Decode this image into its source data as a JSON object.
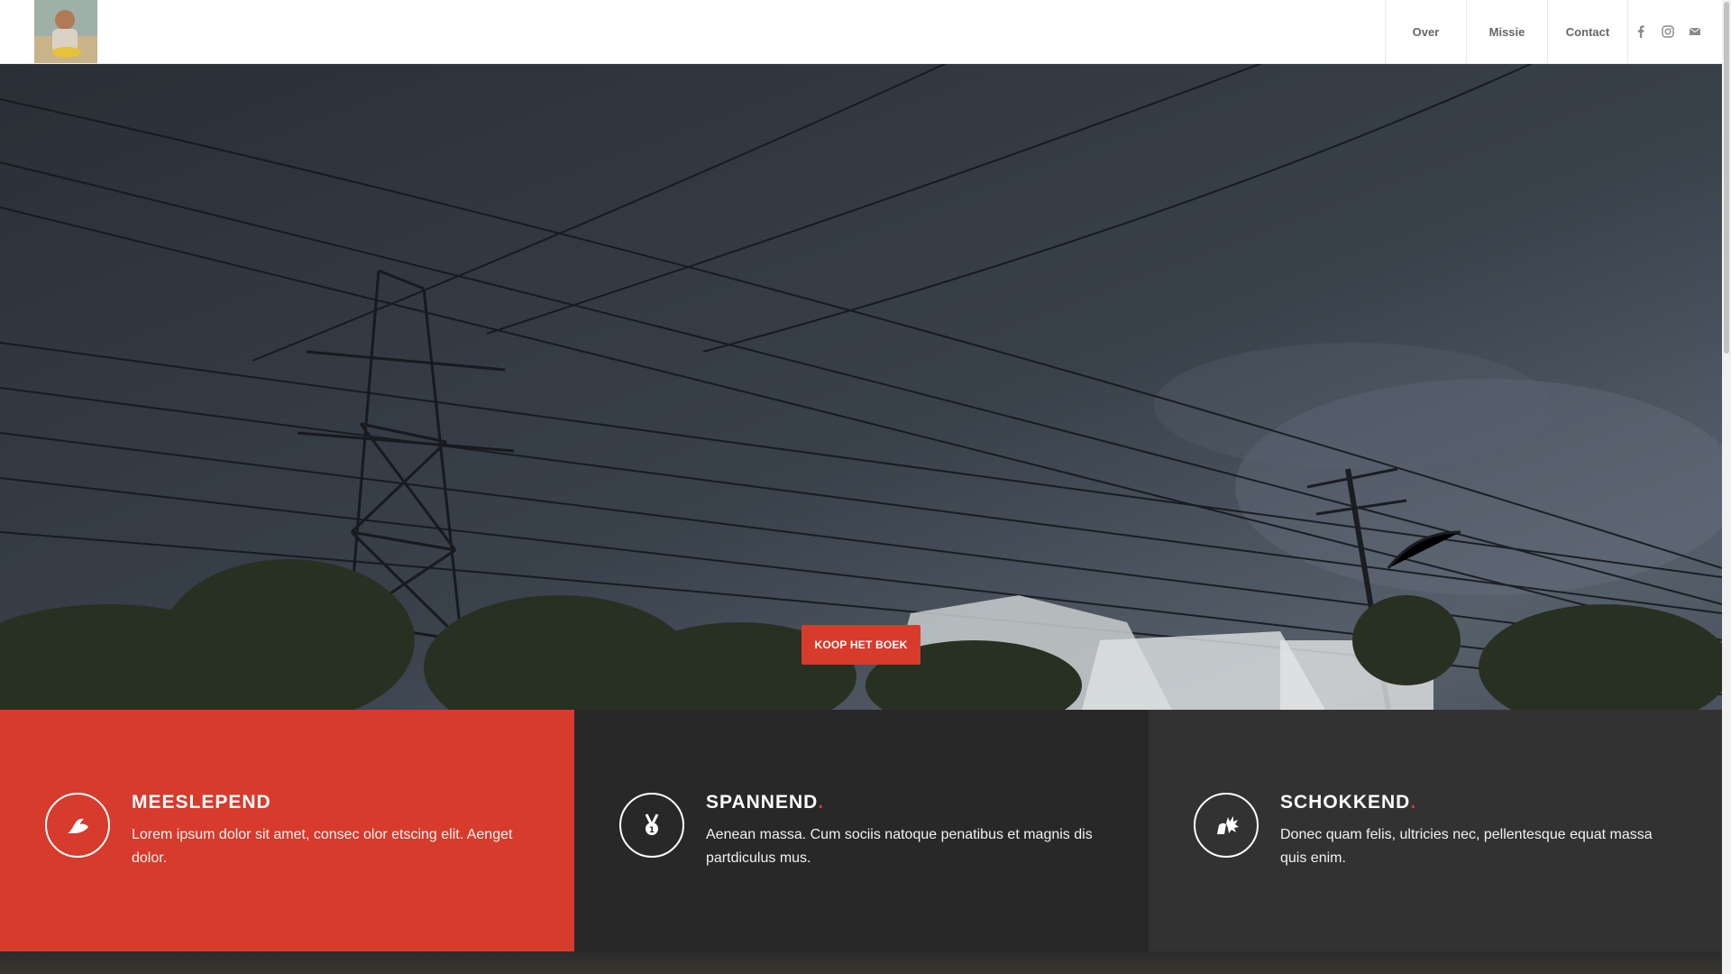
{
  "header": {
    "nav": [
      {
        "label": "Over"
      },
      {
        "label": "Missie"
      },
      {
        "label": "Contact"
      }
    ],
    "socials": [
      "facebook-icon",
      "instagram-icon",
      "mail-icon"
    ]
  },
  "hero": {
    "cta_label": "KOOP HET BOEK"
  },
  "features": [
    {
      "title": "MEESLEPEND",
      "dot": "",
      "text": "Lorem ipsum dolor sit amet, consec olor etscing elit. Aenget dolor.",
      "icon": "flexed-arm-icon"
    },
    {
      "title": "SPANNEND",
      "dot": ".",
      "text": "Aenean massa. Cum sociis natoque penatibus et magnis dis partdiculus mus.",
      "icon": "medal-icon"
    },
    {
      "title": "SCHOKKEND",
      "dot": ".",
      "text": "Donec quam felis, ultricies nec, pellentesque equat massa quis enim.",
      "icon": "explosion-icon"
    }
  ],
  "colors": {
    "accent": "#d63b2c",
    "dark": "#282828",
    "darker": "#323232"
  }
}
